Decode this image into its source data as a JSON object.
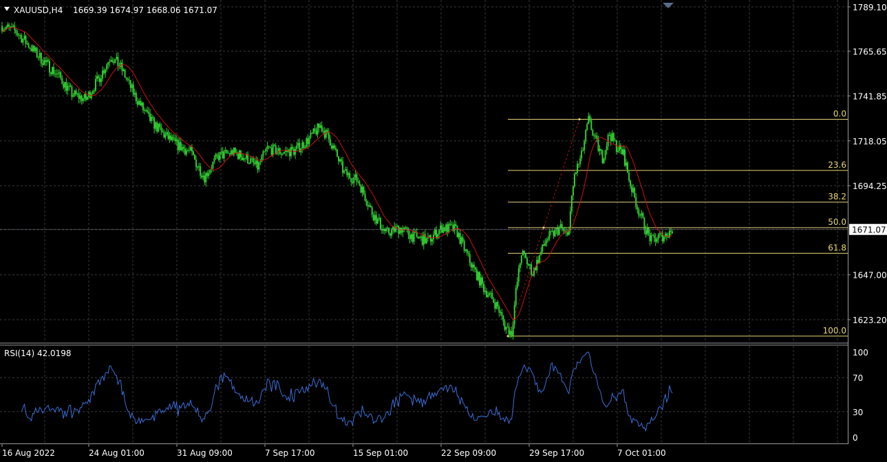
{
  "symbol_header": {
    "symbol": "XAUUSD,H4",
    "ohlc": "1669.39 1674.97 1668.06 1671.07"
  },
  "colors": {
    "background": "#000000",
    "grid": "#3a3a3a",
    "candle": "#32cd32",
    "ma": "#d01010",
    "fib": "#e8d77a",
    "rsi": "#3a6fd8",
    "axis_text": "#ffffff"
  },
  "price_axis": {
    "ticks": [
      "1789.10",
      "1765.65",
      "1741.85",
      "1718.05",
      "1694.25",
      "1671.07",
      "1647.00",
      "1623.20"
    ],
    "current_price": "1671.07"
  },
  "time_axis": {
    "labels": [
      "16 Aug 2022",
      "24 Aug 01:00",
      "31 Aug 09:00",
      "7 Sep 17:00",
      "15 Sep 01:00",
      "22 Sep 09:00",
      "29 Sep 17:00",
      "7 Oct 01:00"
    ]
  },
  "fibonacci": {
    "levels": [
      "0.0",
      "23.6",
      "38.2",
      "50.0",
      "61.8",
      "100.0"
    ],
    "high": 1729.5,
    "low": 1614.5
  },
  "rsi": {
    "label": "RSI(14) 42.0198",
    "ticks": [
      "100",
      "70",
      "30",
      "0"
    ]
  },
  "chart_data": {
    "type": "candlestick",
    "symbol": "XAUUSD",
    "timeframe": "H4",
    "ylim": [
      1612,
      1794
    ],
    "close_path": [
      [
        0,
        1779
      ],
      [
        10,
        1776
      ],
      [
        20,
        1768
      ],
      [
        30,
        1760
      ],
      [
        40,
        1753
      ],
      [
        50,
        1743
      ],
      [
        60,
        1740
      ],
      [
        70,
        1752
      ],
      [
        78,
        1763
      ],
      [
        85,
        1757
      ],
      [
        95,
        1742
      ],
      [
        105,
        1730
      ],
      [
        115,
        1722
      ],
      [
        125,
        1716
      ],
      [
        135,
        1712
      ],
      [
        140,
        1705
      ],
      [
        145,
        1699
      ],
      [
        150,
        1705
      ],
      [
        155,
        1710
      ],
      [
        165,
        1712
      ],
      [
        175,
        1709
      ],
      [
        183,
        1704
      ],
      [
        190,
        1714
      ],
      [
        200,
        1712
      ],
      [
        210,
        1713
      ],
      [
        220,
        1719
      ],
      [
        228,
        1726
      ],
      [
        235,
        1718
      ],
      [
        245,
        1701
      ],
      [
        255,
        1697
      ],
      [
        265,
        1680
      ],
      [
        275,
        1669
      ],
      [
        285,
        1672
      ],
      [
        295,
        1667
      ],
      [
        305,
        1665
      ],
      [
        315,
        1672
      ],
      [
        325,
        1671
      ],
      [
        335,
        1654
      ],
      [
        345,
        1640
      ],
      [
        355,
        1630
      ],
      [
        360,
        1620
      ],
      [
        365,
        1616
      ],
      [
        368,
        1638
      ],
      [
        372,
        1659
      ],
      [
        380,
        1648
      ],
      [
        390,
        1666
      ],
      [
        400,
        1672
      ],
      [
        405,
        1667
      ],
      [
        410,
        1700
      ],
      [
        415,
        1710
      ],
      [
        420,
        1729
      ],
      [
        425,
        1718
      ],
      [
        430,
        1709
      ],
      [
        435,
        1722
      ],
      [
        440,
        1715
      ],
      [
        445,
        1711
      ],
      [
        450,
        1695
      ],
      [
        455,
        1683
      ],
      [
        460,
        1673
      ],
      [
        465,
        1665
      ],
      [
        470,
        1667
      ],
      [
        475,
        1668
      ],
      [
        480,
        1671
      ]
    ]
  }
}
